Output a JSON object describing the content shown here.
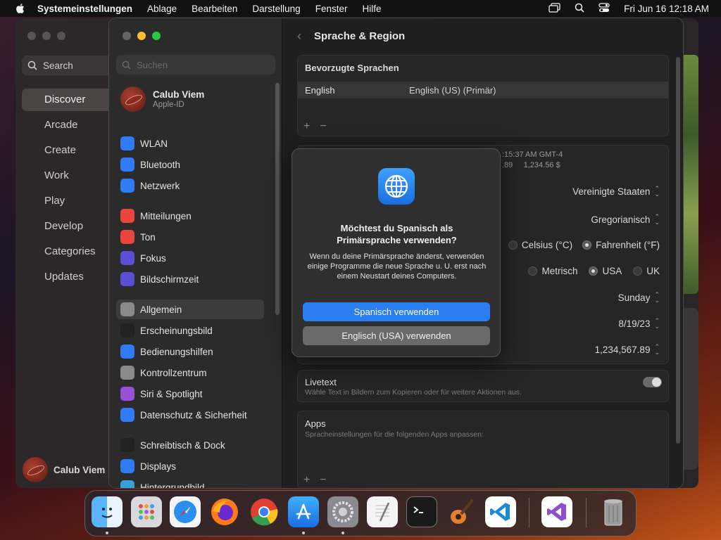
{
  "menubar": {
    "items": [
      "Systemeinstellungen",
      "Ablage",
      "Bearbeiten",
      "Darstellung",
      "Fenster",
      "Hilfe"
    ],
    "clock": "Fri Jun 16  12:18 AM"
  },
  "appstore": {
    "search_label": "Search",
    "nav": [
      "Discover",
      "Arcade",
      "Create",
      "Work",
      "Play",
      "Develop",
      "Categories",
      "Updates"
    ],
    "user": "Calub Viem"
  },
  "settings": {
    "search_placeholder": "Suchen",
    "account": {
      "name": "Calub Viem",
      "sub": "Apple-ID"
    },
    "sidebar": [
      {
        "label": "WLAN",
        "icon": "wifi-icon",
        "color": "#2f7cf6"
      },
      {
        "label": "Bluetooth",
        "icon": "bluetooth-icon",
        "color": "#2f7cf6"
      },
      {
        "label": "Netzwerk",
        "icon": "globe-icon",
        "color": "#2f7cf6"
      },
      {
        "label": "Mitteilungen",
        "icon": "bell-icon",
        "color": "#e9463d"
      },
      {
        "label": "Ton",
        "icon": "speaker-icon",
        "color": "#e9463d"
      },
      {
        "label": "Fokus",
        "icon": "moon-icon",
        "color": "#5b4fd6"
      },
      {
        "label": "Bildschirmzeit",
        "icon": "hourglass-icon",
        "color": "#5b4fd6"
      },
      {
        "label": "Allgemein",
        "icon": "gear-icon",
        "color": "#8a8a8a"
      },
      {
        "label": "Erscheinungsbild",
        "icon": "appearance-icon",
        "color": "#222222"
      },
      {
        "label": "Bedienungshilfen",
        "icon": "accessibility-icon",
        "color": "#2f7cf6"
      },
      {
        "label": "Kontrollzentrum",
        "icon": "control-center-icon",
        "color": "#8a8a8a"
      },
      {
        "label": "Siri & Spotlight",
        "icon": "siri-icon",
        "color": "#9b4fd6"
      },
      {
        "label": "Datenschutz & Sicherheit",
        "icon": "hand-icon",
        "color": "#2f7cf6"
      },
      {
        "label": "Schreibtisch & Dock",
        "icon": "dock-icon",
        "color": "#222222"
      },
      {
        "label": "Displays",
        "icon": "display-icon",
        "color": "#2f7cf6"
      },
      {
        "label": "Hintergrundbild",
        "icon": "wallpaper-icon",
        "color": "#38a0d8"
      }
    ],
    "header": {
      "title": "Sprache & Region"
    },
    "preferred": {
      "title": "Bevorzugte Sprachen",
      "row": {
        "lang": "English",
        "detail": "English (US) (Primär)"
      }
    },
    "region": {
      "preview_time": ":15:37 AM GMT-4",
      "preview_nums": ".89     1,234.56 $",
      "region_value": "Vereinigte Staaten",
      "calendar_value": "Gregorianisch",
      "temp_celsius": "Celsius (°C)",
      "temp_fahrenheit": "Fahrenheit (°F)",
      "measure_metric": "Metrisch",
      "measure_usa": "USA",
      "measure_uk": "UK",
      "first_day": "Sunday",
      "date_format": "8/19/23",
      "number_format": "1,234,567.89"
    },
    "livetext": {
      "title": "Livetext",
      "desc": "Wähle Text in Bildern zum Kopieren oder für weitere Aktionen aus."
    },
    "apps": {
      "title": "Apps",
      "desc": "Spracheinstellungen für die folgenden Apps anpassen:"
    }
  },
  "dialog": {
    "title": "Möchtest du Spanisch als Primärsprache verwenden?",
    "text": "Wenn du deine Primärsprache änderst, verwenden einige Programme die neue Sprache u. U. erst nach einem Neustart deines Computers.",
    "primary": "Spanisch verwenden",
    "secondary": "Englisch (USA) verwenden"
  },
  "dock": [
    "Finder",
    "Launchpad",
    "Safari",
    "Firefox",
    "Chrome",
    "App Store",
    "Systemeinstellungen",
    "TextEdit",
    "Terminal",
    "GarageBand",
    "Visual Studio Code",
    "Visual Studio",
    "Papierkorb"
  ]
}
